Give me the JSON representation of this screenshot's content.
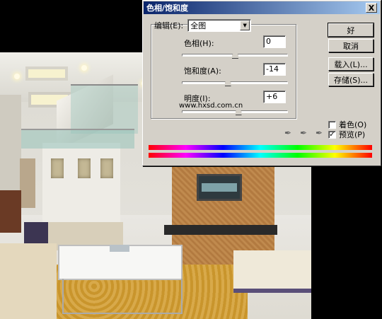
{
  "dialog": {
    "title": "色相/饱和度",
    "close_symbol": "X",
    "edit_label": "编辑(E):",
    "edit_value": "全图",
    "hue": {
      "label": "色相(H):",
      "value": "0",
      "level": 0.5
    },
    "saturation": {
      "label": "饱和度(A):",
      "value": "-14",
      "level": 0.43
    },
    "lightness": {
      "label": "明度(I):",
      "value": "+6",
      "level": 0.53
    },
    "watermark": "www.hxsd.com.cn",
    "buttons": {
      "ok": "好",
      "cancel": "取消",
      "load": "载入(L)...",
      "save": "存储(S)..."
    },
    "colorize": {
      "label": "着色(O)",
      "checked": false
    },
    "preview": {
      "label": "预览(P)",
      "checked": true,
      "mark": "✓"
    },
    "icons": [
      "eyedropper-icon",
      "eyedropper-plus-icon",
      "eyedropper-minus-icon"
    ]
  }
}
